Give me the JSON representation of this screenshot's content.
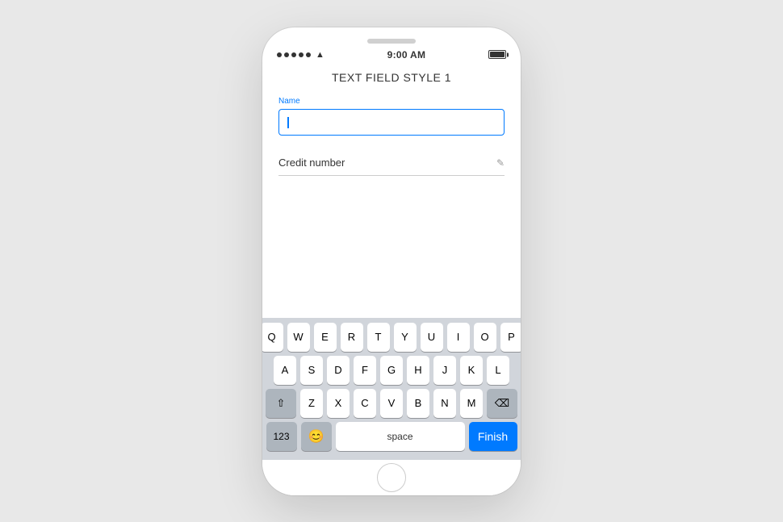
{
  "statusBar": {
    "time": "9:00 AM",
    "signalDots": 5,
    "hasBattery": true
  },
  "screen": {
    "title": "TEXT FIELD STYLE 1",
    "form": {
      "nameLabel": "Name",
      "namePlaceholder": "",
      "creditFieldLabel": "Credit number",
      "editIcon": "✎"
    }
  },
  "keyboard": {
    "row1": [
      "Q",
      "W",
      "E",
      "R",
      "T",
      "Y",
      "U",
      "I",
      "O",
      "P"
    ],
    "row2": [
      "A",
      "S",
      "D",
      "F",
      "G",
      "H",
      "J",
      "K",
      "L"
    ],
    "row3": [
      "Z",
      "X",
      "C",
      "V",
      "B",
      "N",
      "M"
    ],
    "shiftLabel": "⇧",
    "backspaceLabel": "⌫",
    "numbersLabel": "123",
    "emojiLabel": "😊",
    "spaceLabel": "space",
    "finishLabel": "Finish"
  }
}
